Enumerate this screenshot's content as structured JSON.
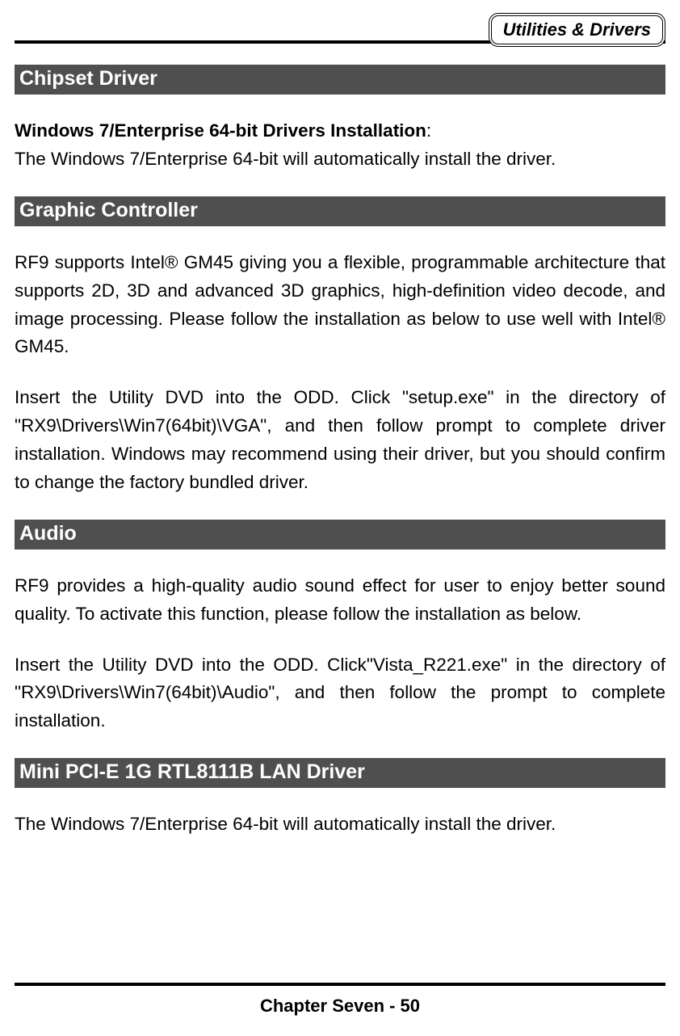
{
  "header": {
    "title": "Utilities & Drivers"
  },
  "sections": {
    "chipset": {
      "heading": "Chipset Driver",
      "sub_bold": "Windows 7/Enterprise 64-bit Drivers Installation",
      "sub_after": ":",
      "body": "The Windows 7/Enterprise 64-bit will automatically install the driver."
    },
    "graphic": {
      "heading": "Graphic Controller",
      "p1": "RF9 supports Intel® GM45 giving you a flexible, programmable architecture that supports 2D, 3D and advanced 3D graphics, high-definition video decode, and image processing. Please follow the installation as below to use well with Intel® GM45.",
      "p2": "Insert the Utility DVD into the ODD. Click \"setup.exe\" in the directory of \"RX9\\Drivers\\Win7(64bit)\\VGA\", and then follow prompt to complete driver installation. Windows may recommend using their driver, but you should confirm to change the factory bundled driver."
    },
    "audio": {
      "heading": "Audio",
      "p1": "RF9 provides a high-quality audio sound effect for user to enjoy better sound quality. To activate this function, please follow the installation as below.",
      "p2": "Insert the Utility DVD into the ODD. Click\"Vista_R221.exe\" in the directory of \"RX9\\Drivers\\Win7(64bit)\\Audio\", and then follow the prompt to complete installation."
    },
    "lan": {
      "heading": "Mini PCI-E 1G RTL8111B LAN Driver",
      "p1": "The Windows 7/Enterprise 64-bit will automatically install the driver."
    }
  },
  "footer": {
    "text": "Chapter Seven - 50"
  }
}
